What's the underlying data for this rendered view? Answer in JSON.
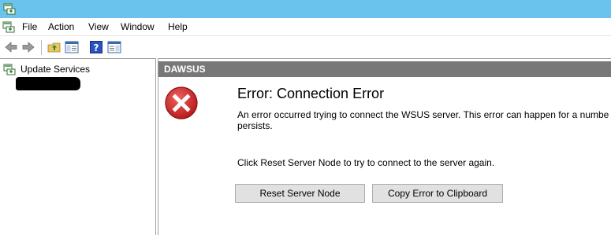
{
  "menubar": {
    "items": [
      {
        "label": "File"
      },
      {
        "label": "Action"
      },
      {
        "label": "View"
      },
      {
        "label": "Window"
      },
      {
        "label": "Help"
      }
    ]
  },
  "toolbar": {
    "icons": [
      "back-arrow-icon",
      "forward-arrow-icon",
      "folder-up-icon",
      "show-hide-console-tree-icon",
      "help-icon",
      "show-hide-action-pane-icon"
    ]
  },
  "tree": {
    "root_label": "Update Services"
  },
  "main": {
    "header_title": "DAWSUS",
    "error_title": "Error: Connection Error",
    "error_description": "An error occurred trying to connect the WSUS server. This error can happen for a number o",
    "error_description_cont": "persists.",
    "instruction": "Click Reset Server Node to try to connect to the server again.",
    "reset_button": "Reset Server Node",
    "copy_button": "Copy Error to Clipboard"
  },
  "colors": {
    "titlebar": "#6ac3ec",
    "header_bar": "#787878",
    "error_red": "#d42d2d",
    "button_face": "#e1e1e1"
  }
}
